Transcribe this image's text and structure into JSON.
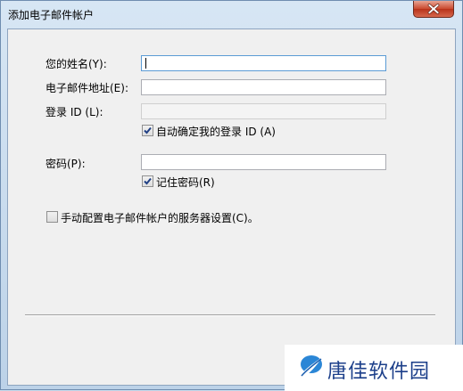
{
  "window": {
    "title": "添加电子邮件帐户"
  },
  "form": {
    "name_label": "您的姓名(Y):",
    "name_value": "",
    "email_label": "电子邮件地址(E):",
    "email_value": "",
    "login_label": "登录 ID (L):",
    "login_value": "",
    "auto_login_label": "自动确定我的登录 ID (A)",
    "auto_login_checked": true,
    "password_label": "密码(P):",
    "password_value": "",
    "remember_label": "记住密码(R)",
    "remember_checked": true,
    "manual_label": "手动配置电子邮件帐户的服务器设置(C)。",
    "manual_checked": false
  },
  "watermark": {
    "text": "唐佳软件园"
  }
}
